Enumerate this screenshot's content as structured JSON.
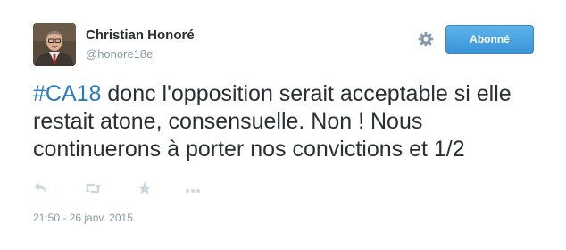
{
  "user": {
    "display_name": "Christian Honoré",
    "screen_name": "@honore18e"
  },
  "follow_button": {
    "label": "Abonné"
  },
  "tweet": {
    "hashtag": "#CA18",
    "text": " donc l'opposition serait acceptable si elle restait atone, consensuelle. Non ! Nous continuerons à porter nos convictions et 1/2",
    "timestamp": "21:50 - 26 janv. 2015"
  },
  "icons": {
    "settings": "gear-icon",
    "reply": "reply-icon",
    "retweet": "retweet-icon",
    "favorite": "star-icon",
    "more": "more-icon"
  },
  "colors": {
    "accent": "#2b7bb9",
    "button": "#4ca3e3",
    "muted": "#8899a6",
    "text": "#292f33",
    "icon": "#ccd6dd"
  }
}
